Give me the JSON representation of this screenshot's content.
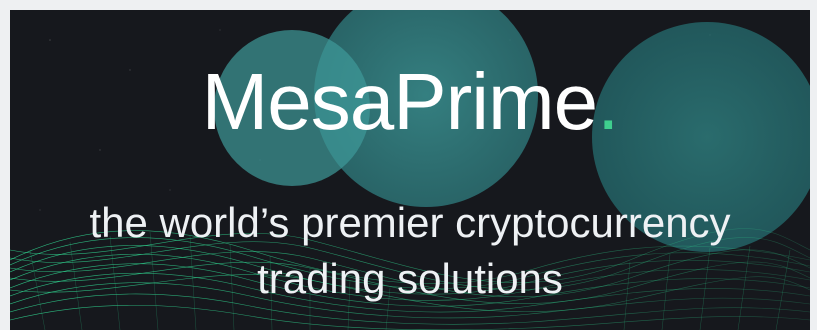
{
  "banner": {
    "brand_name": "MesaPrime",
    "brand_dot": ".",
    "tagline_line1": "the world’s premier cryptocurrency",
    "tagline_line2": "trading solutions"
  },
  "colors": {
    "background": "#16181d",
    "circle": "#3a8f8f",
    "accent_dot": "#3fcf8e",
    "wave": "#2ecc8a",
    "text": "#ffffff"
  }
}
